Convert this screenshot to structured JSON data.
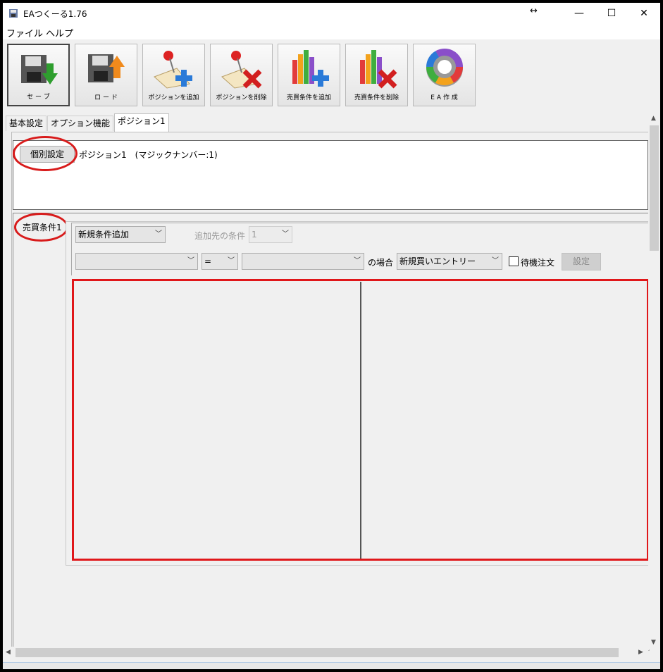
{
  "window": {
    "title": "EAつくーる1.76"
  },
  "titlebar_controls": {
    "resize_cursor": "↔",
    "minimize": "—",
    "maximize": "☐",
    "close": "✕"
  },
  "menu": [
    "ファイル",
    "ヘルプ"
  ],
  "toolbar": [
    {
      "label": "セ ー ブ",
      "icon": "save-icon"
    },
    {
      "label": "ロ ー ド",
      "icon": "load-icon"
    },
    {
      "label": "ポジションを追加",
      "icon": "add-position-icon"
    },
    {
      "label": "ポジションを削除",
      "icon": "delete-position-icon"
    },
    {
      "label": "売買条件を追加",
      "icon": "add-condition-icon"
    },
    {
      "label": "売買条件を削除",
      "icon": "delete-condition-icon"
    },
    {
      "label": "E A 作 成",
      "icon": "create-ea-icon"
    }
  ],
  "tabs": [
    "基本設定",
    "オプション機能",
    "ポジション1"
  ],
  "position": {
    "button_label": "個別設定",
    "title": "ポジション1　(マジックナンバー:1)"
  },
  "condition": {
    "tab_label": "売買条件1",
    "new_condition": "新規条件追加",
    "target_label": "追加先の条件",
    "target_value": "1",
    "operator": "=",
    "case_label": "の場合",
    "entry_type": "新規買いエントリー",
    "pending_label": "待機注文",
    "set_button": "設定"
  },
  "colors": {
    "highlight": "#e0171a",
    "window_bg": "#f0f0f0"
  }
}
